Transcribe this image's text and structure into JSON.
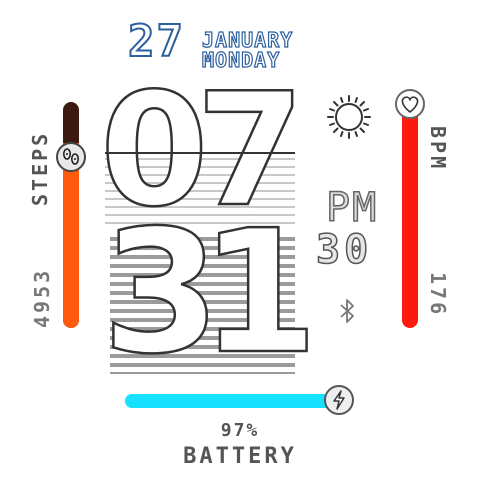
{
  "date": {
    "day": "27",
    "month": "JANUARY",
    "weekday": "MONDAY"
  },
  "time": {
    "hour_tens": "0",
    "hour_ones": "7",
    "minute_tens": "3",
    "minute_ones": "1",
    "ampm": "PM",
    "seconds": "30"
  },
  "steps": {
    "label": "STEPS",
    "value": "4953",
    "progress": 0.82
  },
  "heart": {
    "label": "BPM",
    "value": "176",
    "progress": 0.98
  },
  "battery": {
    "label": "BATTERY",
    "percent_text": "97%",
    "level": 0.97
  },
  "colors": {
    "steps": "#ff5a0e",
    "heart": "#ff1a10",
    "battery": "#18e0ff",
    "date": "#2b5f9e"
  },
  "icons": {
    "weather": "sun-icon",
    "steps": "footprints-icon",
    "heart": "heart-icon",
    "battery": "lightning-icon",
    "connection": "bluetooth-icon"
  }
}
